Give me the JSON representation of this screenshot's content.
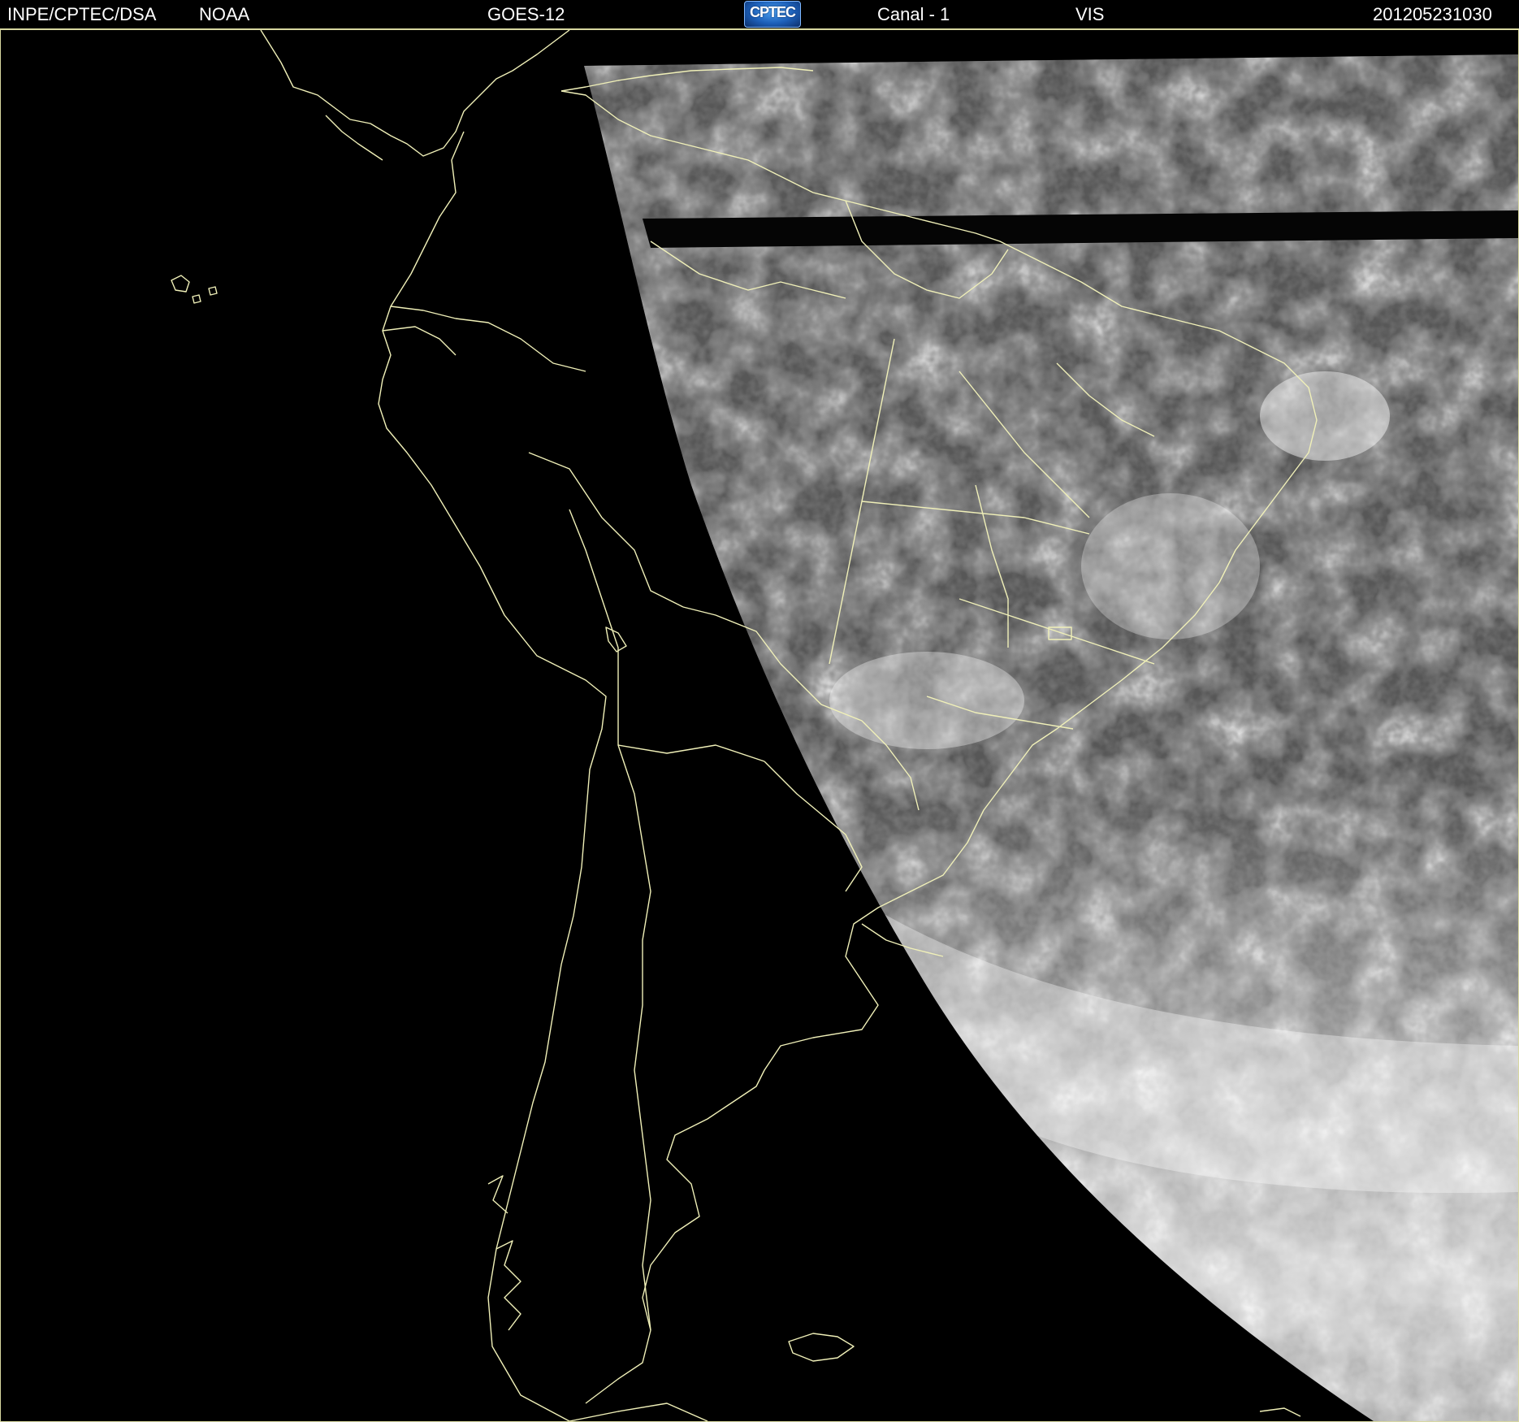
{
  "header": {
    "agency": "INPE/CPTEC/DSA",
    "source": "NOAA",
    "satellite": "GOES-12",
    "logo_text": "CPTEC",
    "channel": "Canal - 1",
    "band": "VIS",
    "timestamp": "201205231030"
  },
  "colors": {
    "background": "#000000",
    "header_text": "#ffffff",
    "coastline": "#f0f0b8",
    "earth_disk": "#5a5a5a",
    "cloud": "#e8e8e8",
    "logo_blue": "#1c5fb8"
  },
  "map": {
    "projection_view": "GOES-12 visible channel imagery over South America",
    "icons": [
      "cptec-logo-icon"
    ]
  }
}
